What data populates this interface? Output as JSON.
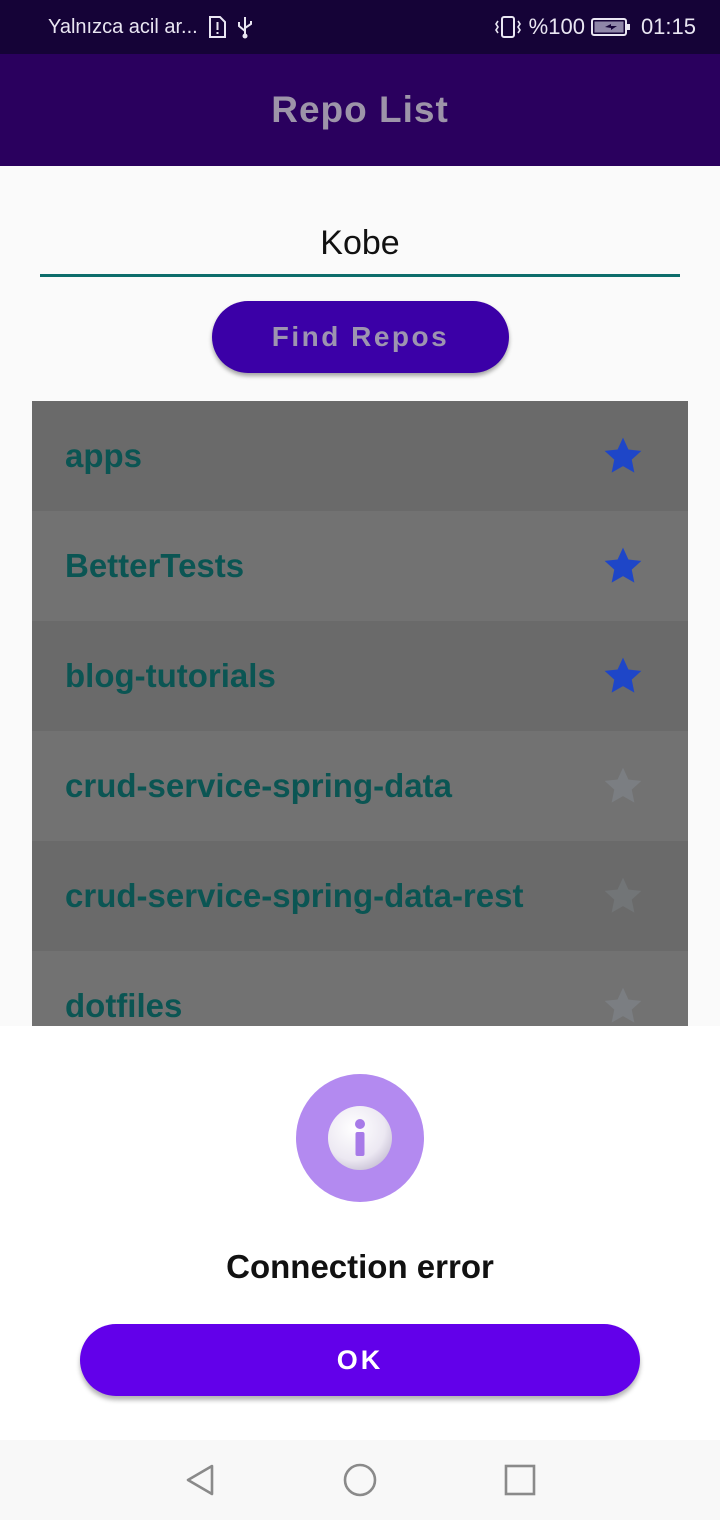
{
  "status_bar": {
    "carrier_text": "Yalnızca acil ar...",
    "battery_percent": "%100",
    "time": "01:15",
    "icons": [
      "sim-alert-icon",
      "usb-icon",
      "vibrate-icon",
      "battery-charging-icon"
    ]
  },
  "toolbar": {
    "title": "Repo List"
  },
  "search": {
    "value": "Kobe"
  },
  "find_button": {
    "label": "Find Repos"
  },
  "repos": [
    {
      "name": "apps",
      "starred": true
    },
    {
      "name": "BetterTests",
      "starred": true
    },
    {
      "name": "blog-tutorials",
      "starred": true
    },
    {
      "name": "crud-service-spring-data",
      "starred": false
    },
    {
      "name": "crud-service-spring-data-rest",
      "starred": false
    },
    {
      "name": "dotfiles",
      "starred": false
    }
  ],
  "dialog": {
    "icon": "info-icon",
    "title": "Connection error",
    "ok_label": "OK"
  },
  "colors": {
    "status_bar": "#150337",
    "toolbar": "#2a005e",
    "accent": "#6200ea",
    "star_on": "#1e46c8",
    "star_off": "#7b7b7b",
    "repo_text": "#0b5553",
    "info_circle": "#b38af0"
  },
  "nav_bar": {
    "icons": [
      "back-icon",
      "home-icon",
      "recents-icon"
    ]
  }
}
